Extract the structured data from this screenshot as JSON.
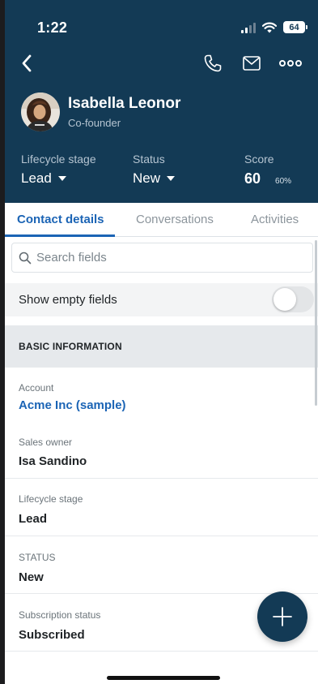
{
  "status_bar": {
    "time": "1:22",
    "battery": "64"
  },
  "header": {
    "name": "Isabella Leonor",
    "title": "Co-founder",
    "lifecycle_label": "Lifecycle stage",
    "lifecycle_value": "Lead",
    "status_label": "Status",
    "status_value": "New",
    "score_label": "Score",
    "score_value": "60",
    "score_percent": "60%"
  },
  "tabs": [
    {
      "label": "Contact details",
      "active": true
    },
    {
      "label": "Conversations",
      "active": false
    },
    {
      "label": "Activities",
      "active": false
    }
  ],
  "search": {
    "placeholder": "Search fields",
    "value": ""
  },
  "toggle": {
    "label": "Show empty fields",
    "on": false
  },
  "section": {
    "title": "BASIC INFORMATION"
  },
  "fields": [
    {
      "label": "Account",
      "value": "Acme Inc (sample)",
      "link": true
    },
    {
      "label": "Sales owner",
      "value": "Isa Sandino"
    },
    {
      "label": "Lifecycle stage",
      "value": "Lead"
    },
    {
      "label": "STATUS",
      "value": "New"
    },
    {
      "label": "Subscription status",
      "value": "Subscribed"
    }
  ],
  "colors": {
    "header": "#133a55",
    "accent": "#1b64b5"
  },
  "icons": [
    "back-icon",
    "phone-icon",
    "mail-icon",
    "more-icon",
    "search-icon",
    "plus-icon"
  ]
}
